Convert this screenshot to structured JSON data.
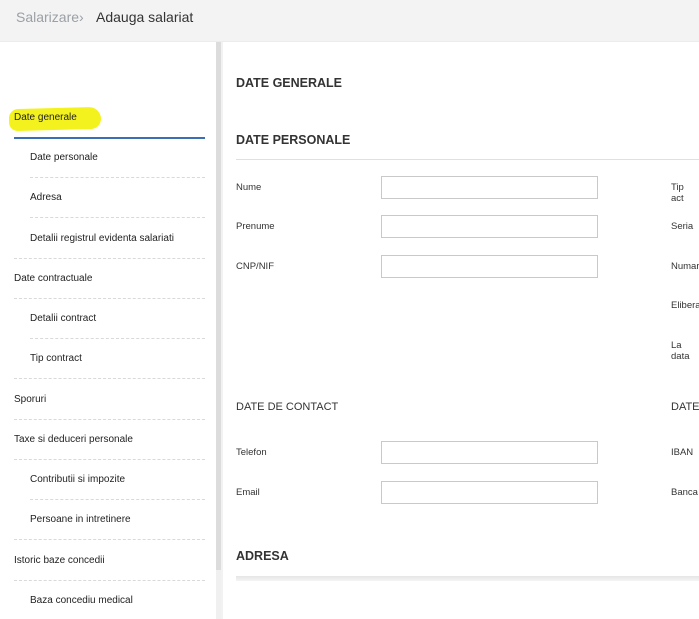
{
  "breadcrumb": {
    "root": "Salarizare",
    "separator": "›",
    "current": "Adauga salariat"
  },
  "sidebar": {
    "items": [
      {
        "label": "Date generale",
        "level": 0,
        "active": true
      },
      {
        "label": "Date personale",
        "level": 1
      },
      {
        "label": "Adresa",
        "level": 1
      },
      {
        "label": "Detalii registrul evidenta salariati",
        "level": 1
      },
      {
        "label": "Date contractuale",
        "level": 0
      },
      {
        "label": "Detalii contract",
        "level": 1
      },
      {
        "label": "Tip contract",
        "level": 1
      },
      {
        "label": "Sporuri",
        "level": 0
      },
      {
        "label": "Taxe si deduceri personale",
        "level": 0
      },
      {
        "label": "Contributii si impozite",
        "level": 1
      },
      {
        "label": "Persoane in intretinere",
        "level": 1
      },
      {
        "label": "Istoric baze concedii",
        "level": 0
      },
      {
        "label": "Baza concediu medical",
        "level": 1
      }
    ]
  },
  "main": {
    "general_title": "DATE GENERALE",
    "personal": {
      "title": "DATE PERSONALE",
      "fields": [
        {
          "label": "Nume",
          "value": "",
          "placeholder": ""
        },
        {
          "label": "Prenume",
          "value": "",
          "placeholder": ""
        },
        {
          "label": "CNP/NIF",
          "value": "",
          "placeholder": ""
        }
      ],
      "right_labels": [
        "Tip act",
        "Seria",
        "Numar",
        "Eliberat",
        "La data"
      ]
    },
    "contact": {
      "title": "DATE DE CONTACT",
      "fields": [
        {
          "label": "Telefon",
          "value": "",
          "placeholder": ""
        },
        {
          "label": "Email",
          "value": "",
          "placeholder": ""
        }
      ]
    },
    "bank": {
      "title": "DATE",
      "right_labels": [
        "IBAN",
        "Banca"
      ]
    },
    "address_title": "ADRESA"
  },
  "colors": {
    "highlight": "#f3f21f",
    "active_underline": "#3a6fb5"
  }
}
